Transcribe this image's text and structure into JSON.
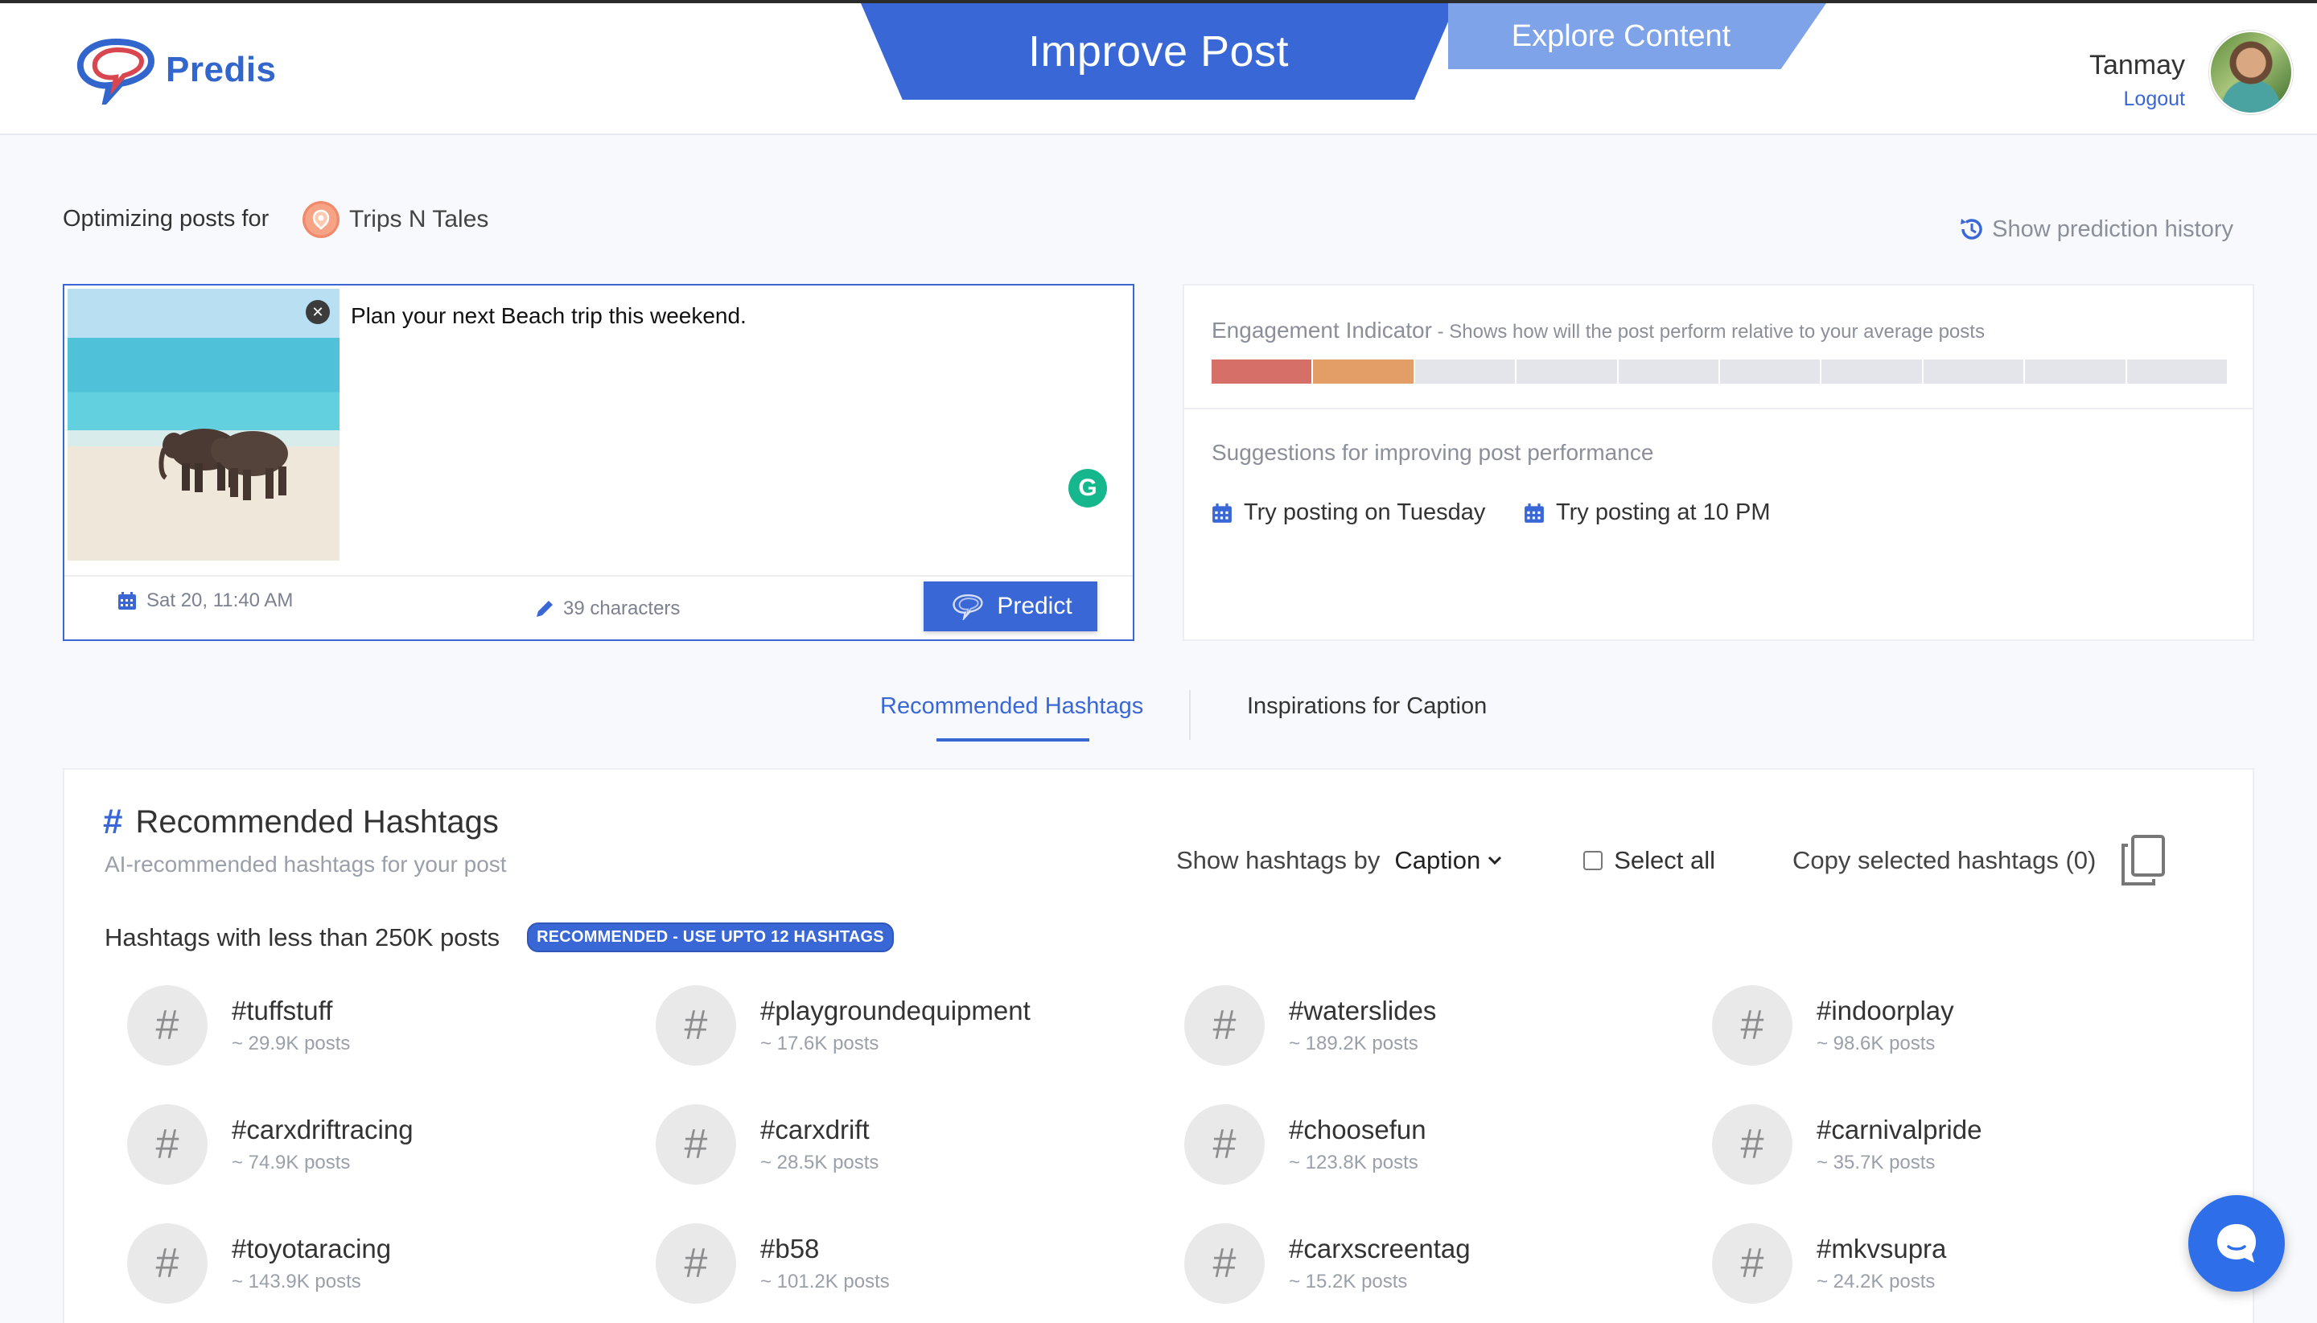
{
  "brand": {
    "name": "Predis"
  },
  "nav": {
    "improve": "Improve Post",
    "explore": "Explore Content"
  },
  "user": {
    "name": "Tanmay",
    "logout": "Logout"
  },
  "context": {
    "label": "Optimizing posts for",
    "account": "Trips N Tales",
    "history": "Show prediction history"
  },
  "editor": {
    "text": "Plan your next Beach trip this weekend.",
    "date": "Sat 20, 11:40 AM",
    "chars": "39 characters",
    "predict": "Predict"
  },
  "engagement": {
    "title": "Engagement Indicator",
    "subtitle": " - Shows how will the post perform relative to your average posts",
    "level": 2,
    "segments": 10,
    "colors": {
      "low": "#d56f68",
      "mid": "#e39d66",
      "empty": "#e4e5ea"
    }
  },
  "suggestions": {
    "title": "Suggestions for improving post performance",
    "items": [
      "Try posting on Tuesday",
      "Try posting at 10 PM"
    ]
  },
  "tabs": {
    "recommended": "Recommended Hashtags",
    "inspirations": "Inspirations for Caption"
  },
  "hashtags": {
    "title": "Recommended Hashtags",
    "subtitle": "AI-recommended hashtags for your post",
    "show_by_label": "Show hashtags by",
    "show_by_value": "Caption",
    "select_all": "Select all",
    "copy": "Copy selected hashtags (0)",
    "section_label": "Hashtags with less than 250K posts",
    "badge": "RECOMMENDED - USE UPTO 12 HASHTAGS",
    "items": [
      {
        "tag": "#tuffstuff",
        "posts": "~ 29.9K posts"
      },
      {
        "tag": "#playgroundequipment",
        "posts": "~ 17.6K posts"
      },
      {
        "tag": "#waterslides",
        "posts": "~ 189.2K posts"
      },
      {
        "tag": "#indoorplay",
        "posts": "~ 98.6K posts"
      },
      {
        "tag": "#carxdriftracing",
        "posts": "~ 74.9K posts"
      },
      {
        "tag": "#carxdrift",
        "posts": "~ 28.5K posts"
      },
      {
        "tag": "#choosefun",
        "posts": "~ 123.8K posts"
      },
      {
        "tag": "#carnivalpride",
        "posts": "~ 35.7K posts"
      },
      {
        "tag": "#toyotaracing",
        "posts": "~ 143.9K posts"
      },
      {
        "tag": "#b58",
        "posts": "~ 101.2K posts"
      },
      {
        "tag": "#carxscreentag",
        "posts": "~ 15.2K posts"
      },
      {
        "tag": "#mkvsupra",
        "posts": "~ 24.2K posts"
      }
    ]
  },
  "accent": "#3a67d6"
}
